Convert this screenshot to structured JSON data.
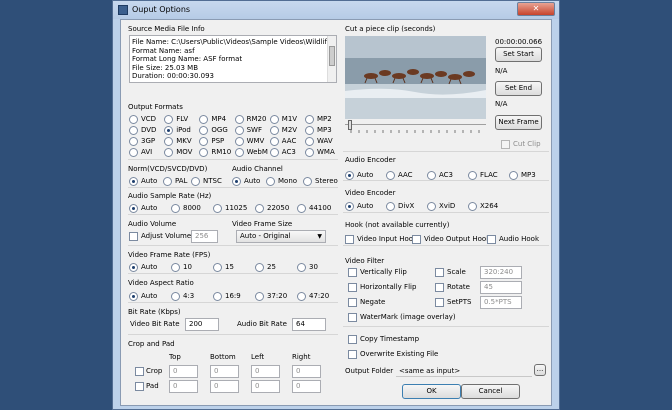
{
  "window": {
    "title": "Ouput Options",
    "close_glyph": "✕",
    "minimize_glyph": "▁",
    "icon": "app-icon"
  },
  "source": {
    "heading": "Source Media File Info",
    "lines": [
      "File Name: C:\\Users\\Public\\Videos\\Sample Videos\\Wildlife.wm",
      "Format Name: asf",
      "Format Long Name: ASF format",
      "File Size: 25.03 MB",
      "Duration: 00:00:30.093"
    ]
  },
  "clip": {
    "heading": "Cut a piece clip (seconds)",
    "time": "00:00:00.066",
    "set_start": "Set Start",
    "start_value": "N/A",
    "set_end": "Set End",
    "end_value": "N/A",
    "next_frame": "Next Frame",
    "cut_clip": "Cut Clip"
  },
  "output_formats": {
    "heading": "Output Formats",
    "rows": [
      [
        "VCD",
        "FLV",
        "MP4",
        "RM20",
        "M1V",
        "MP2"
      ],
      [
        "DVD",
        "iPod",
        "OGG",
        "SWF",
        "M2V",
        "MP3"
      ],
      [
        "3GP",
        "MKV",
        "PSP",
        "WMV",
        "AAC",
        "WAV"
      ],
      [
        "AVI",
        "MOV",
        "RM10",
        "WebM",
        "AC3",
        "WMA"
      ]
    ],
    "selected": "iPod"
  },
  "norm": {
    "heading": "Norm(VCD/SVCD/DVD)",
    "options": [
      "Auto",
      "PAL",
      "NTSC"
    ]
  },
  "audio_channel": {
    "heading": "Audio Channel",
    "options": [
      "Auto",
      "Mono",
      "Stereo"
    ]
  },
  "sample_rate": {
    "heading": "Audio Sample Rate (Hz)",
    "options": [
      "Auto",
      "8000",
      "11025",
      "22050",
      "44100"
    ]
  },
  "audio_volume": {
    "heading": "Audio Volume",
    "adjust_label": "Adjust Volume",
    "value": "256"
  },
  "frame_size": {
    "heading": "Video Frame Size",
    "selected": "Auto - Original"
  },
  "frame_rate": {
    "heading": "Video Frame Rate (FPS)",
    "options": [
      "Auto",
      "10",
      "15",
      "25",
      "30"
    ]
  },
  "aspect": {
    "heading": "Video Aspect Ratio",
    "options": [
      "Auto",
      "4:3",
      "16:9",
      "37:20",
      "47:20"
    ]
  },
  "bitrate": {
    "heading": "Bit Rate (Kbps)",
    "video_label": "Video Bit Rate",
    "video_value": "200",
    "audio_label": "Audio Bit Rate",
    "audio_value": "64"
  },
  "crop": {
    "heading": "Crop and Pad",
    "cols": [
      "Top",
      "Bottom",
      "Left",
      "Right"
    ],
    "crop_label": "Crop",
    "pad_label": "Pad",
    "crop_values": [
      "0",
      "0",
      "0",
      "0"
    ],
    "pad_values": [
      "0",
      "0",
      "0",
      "0"
    ]
  },
  "audio_encoder": {
    "heading": "Audio Encoder",
    "options": [
      "Auto",
      "AAC",
      "AC3",
      "FLAC",
      "MP3"
    ]
  },
  "video_encoder": {
    "heading": "Video Encoder",
    "options": [
      "Auto",
      "DivX",
      "XviD",
      "X264"
    ]
  },
  "hook": {
    "heading": "Hook (not available currently)",
    "options": [
      "Video Input Hook",
      "Video Output Hook",
      "Audio Hook"
    ]
  },
  "filter": {
    "heading": "Video Filter",
    "vflip": "Vertically Flip",
    "hflip": "Horizontally Flip",
    "negate": "Negate",
    "watermark": "WaterMark (image overlay)",
    "scale": "Scale",
    "scale_value": "320:240",
    "rotate": "Rotate",
    "rotate_value": "45",
    "setpts": "SetPTS",
    "setpts_value": "0.5*PTS"
  },
  "copy_ts": "Copy Timestamp",
  "overwrite": "Overwrite Existing File",
  "output_folder": {
    "label": "Output Folder",
    "value": "<same as input>",
    "browse": "..."
  },
  "ok": "OK",
  "cancel": "Cancel"
}
